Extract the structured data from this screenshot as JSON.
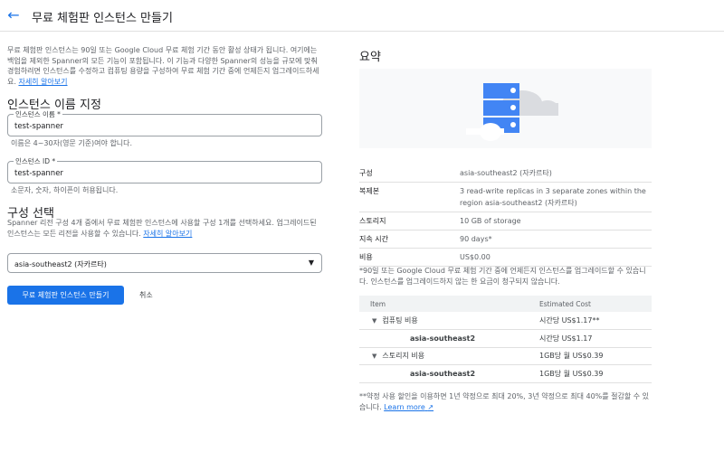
{
  "header": {
    "title": "무료 체험판 인스턴스 만들기"
  },
  "intro": {
    "text": "무료 체험판 인스턴스는 90일 또는 Google Cloud 무료 체험 기간 동안 활성 상태가 됩니다. 여기에는 백업을 제외한 Spanner의 모든 기능이 포함됩니다. 이 기능과 다양한 Spanner의 성능을 규모에 맞춰 경험하려면 인스턴스를 수정하고 컴퓨팅 용량을 구성하여 무료 체험 기간 중에 언제든지 업그레이드하세요.",
    "link": "자세히 알아보기"
  },
  "naming": {
    "heading": "인스턴스 이름 지정",
    "name_field": {
      "label": "인스턴스 이름 *",
      "value": "test-spanner",
      "hint": "이름은 4~30자(영문 기준)여야 합니다."
    },
    "id_field": {
      "label": "인스턴스 ID *",
      "value": "test-spanner",
      "hint": "소문자, 숫자, 하이픈이 허용됩니다."
    }
  },
  "config": {
    "heading": "구성 선택",
    "desc": "Spanner 리전 구성 4개 중에서 무료 체험판 인스턴스에 사용할 구성 1개를 선택하세요. 업그레이드된 인스턴스는 모든 리전을 사용할 수 있습니다.",
    "link": "자세히 알아보기",
    "selected": "asia-southeast2 (자카르타)"
  },
  "actions": {
    "create": "무료 체험판 인스턴스 만들기",
    "cancel": "취소"
  },
  "summary": {
    "heading": "요약",
    "rows": [
      {
        "k": "구성",
        "v": "asia-southeast2 (자카르타)"
      },
      {
        "k": "복제본",
        "v": "3 read-write replicas in 3 separate zones within the region asia-southeast2 (자카르타)"
      },
      {
        "k": "스토리지",
        "v": "10 GB of storage"
      },
      {
        "k": "지속 시간",
        "v": "90 days*"
      },
      {
        "k": "비용",
        "v": "US$0.00"
      }
    ],
    "footnote": "*90일 또는 Google Cloud 무료 체험 기간 중에 언제든지 인스턴스를 업그레이드할 수 있습니다. 인스턴스를 업그레이드하지 않는 한 요금이 청구되지 않습니다."
  },
  "cost_table": {
    "headers": [
      "Item",
      "Estimated Cost"
    ],
    "rows": [
      {
        "item": "컴퓨팅 비용",
        "cost": "시간당 US$1.17**"
      },
      {
        "item": "asia-southeast2",
        "cost": "시간당 US$1.17"
      },
      {
        "item": "스토리지 비용",
        "cost": "1GB당 월 US$0.39"
      },
      {
        "item": "asia-southeast2",
        "cost": "1GB당 월 US$0.39"
      }
    ],
    "footnote": "**약정 사용 할인을 이용하면 1년 약정으로 최대 20%, 3년 약정으로 최대 40%를 절감할 수 있습니다.",
    "link": "Learn more"
  },
  "colors": {
    "accent": "#1a73e8"
  }
}
